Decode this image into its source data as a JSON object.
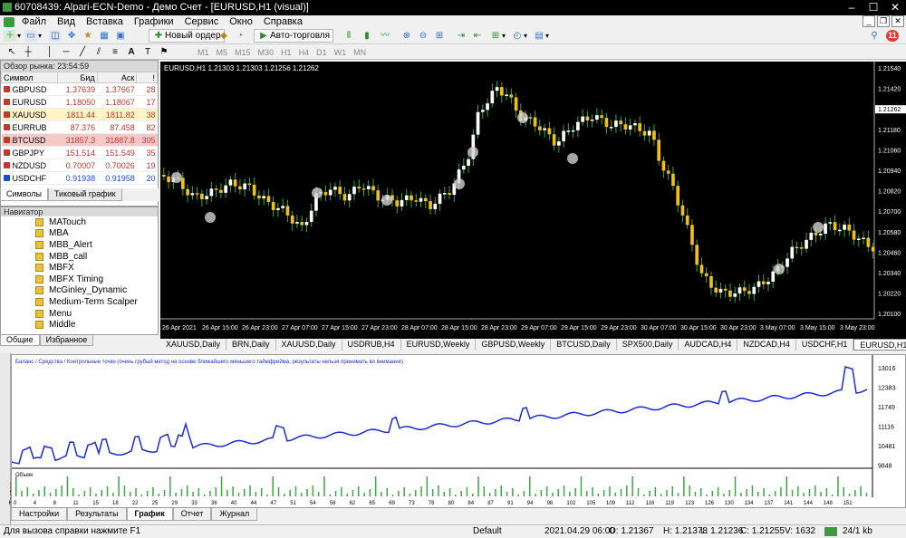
{
  "title": "60708439: Alpari-ECN-Demo - Демо Счет - [EURUSD,H1 (visual)]",
  "menu": [
    "Файл",
    "Вид",
    "Вставка",
    "Графики",
    "Сервис",
    "Окно",
    "Справка"
  ],
  "toolbar": {
    "new_order": "Новый ордер",
    "auto_trading": "Авто-торговля",
    "timeframes": [
      "M1",
      "M5",
      "M15",
      "M30",
      "H1",
      "H4",
      "D1",
      "W1",
      "MN"
    ]
  },
  "market_watch": {
    "title": "Обзор рынка: 23:54:59",
    "columns": [
      "Символ",
      "Бид",
      "Аск",
      "!"
    ],
    "rows": [
      {
        "symbol": "GBPUSD",
        "bid": "1.37639",
        "ask": "1.37667",
        "spread": "28",
        "color": "#c0392b",
        "bg": "#ffffff"
      },
      {
        "symbol": "EURUSD",
        "bid": "1.18050",
        "ask": "1.18067",
        "spread": "17",
        "color": "#c0392b",
        "bg": "#ffffff"
      },
      {
        "symbol": "XAUUSD",
        "bid": "1811.44",
        "ask": "1811.82",
        "spread": "38",
        "color": "#c0392b",
        "bg": "#fff4c8"
      },
      {
        "symbol": "EURRUB",
        "bid": "87.376",
        "ask": "87.458",
        "spread": "82",
        "color": "#c0392b",
        "bg": "#ffffff"
      },
      {
        "symbol": "BTCUSD",
        "bid": "31857.3",
        "ask": "31887.8",
        "spread": "305",
        "color": "#c0392b",
        "bg": "#f6c9c9"
      },
      {
        "symbol": "GBPJPY",
        "bid": "151.514",
        "ask": "151.549",
        "spread": "35",
        "color": "#c0392b",
        "bg": "#ffffff"
      },
      {
        "symbol": "NZDUSD",
        "bid": "0.70007",
        "ask": "0.70026",
        "spread": "19",
        "color": "#c0392b",
        "bg": "#ffffff"
      },
      {
        "symbol": "USDCHF",
        "bid": "0.91938",
        "ask": "0.91958",
        "spread": "20",
        "color": "#1a4bd6",
        "bg": "#ffffff"
      }
    ],
    "tabs": [
      "Символы",
      "Тиковый график"
    ]
  },
  "navigator": {
    "title": "Навигатор",
    "items": [
      "MATouch",
      "MBA",
      "MBB_Alert",
      "MBB_call",
      "MBFX",
      "MBFX Timing",
      "McGinley_Dynamic",
      "Medium-Term Scalper",
      "Menu",
      "Middle"
    ],
    "tabs": [
      "Общие",
      "Избранное"
    ]
  },
  "chart": {
    "header": "EURUSD,H1  1.21303 1.21303 1.21256 1.21262",
    "price_labels": [
      "1.21540",
      "1.21420",
      "1.21262",
      "1.21180",
      "1.21060",
      "1.20940",
      "1.20820",
      "1.20700",
      "1.20580",
      "1.20460",
      "1.20340",
      "1.20220",
      "1.20100"
    ],
    "time_labels": [
      "26 Apr 2021",
      "26 Apr 15:00",
      "26 Apr 23:00",
      "27 Apr 07:00",
      "27 Apr 15:00",
      "27 Apr 23:00",
      "28 Apr 07:00",
      "28 Apr 15:00",
      "28 Apr 23:00",
      "29 Apr 07:00",
      "29 Apr 15:00",
      "29 Apr 23:00",
      "30 Apr 07:00",
      "30 Apr 15:00",
      "30 Apr 23:00",
      "3 May 07:00",
      "3 May 15:00",
      "3 May 23:00"
    ],
    "current_price": "1.21262"
  },
  "chart_tabs": [
    "XAUUSD,Daily",
    "BRN,Daily",
    "XAUUSD,Daily",
    "USDRUB,H4",
    "EURUSD,Weekly",
    "GBPUSD,Weekly",
    "BTCUSD,Daily",
    "SPX500,Daily",
    "AUDCAD,H4",
    "NZDCAD,H4",
    "USDCHF,H1",
    "EURUSD,H1 (visual)"
  ],
  "tester": {
    "legend": "Баланс / Средства / Контрольные точки (очень грубый метод на основе ближайшего меньшего таймфрейма, результаты нельзя принимать во внимание)",
    "y_labels": [
      "13016",
      "12383",
      "11749",
      "11116",
      "10481",
      "9848"
    ],
    "volume_label": "Объем",
    "x_labels": [
      "0",
      "4",
      "8",
      "11",
      "15",
      "18",
      "22",
      "25",
      "29",
      "33",
      "36",
      "40",
      "44",
      "47",
      "51",
      "54",
      "58",
      "62",
      "65",
      "69",
      "73",
      "76",
      "80",
      "84",
      "87",
      "91",
      "94",
      "98",
      "102",
      "105",
      "109",
      "112",
      "116",
      "119",
      "123",
      "126",
      "130",
      "134",
      "137",
      "141",
      "144",
      "148",
      "151"
    ],
    "tabs": [
      "Настройки",
      "Результаты",
      "График",
      "Отчет",
      "Журнал"
    ],
    "side_label": "Тестер"
  },
  "status": {
    "help": "Для вызова справки нажмите F1",
    "profile": "Default",
    "datetime": "2021.04.29 06:00",
    "open": "O: 1.21367",
    "high": "H: 1.21378",
    "low": "L: 1.21236",
    "close": "C: 1.21255",
    "volume": "V: 1632",
    "traffic": "24/1 kb"
  }
}
